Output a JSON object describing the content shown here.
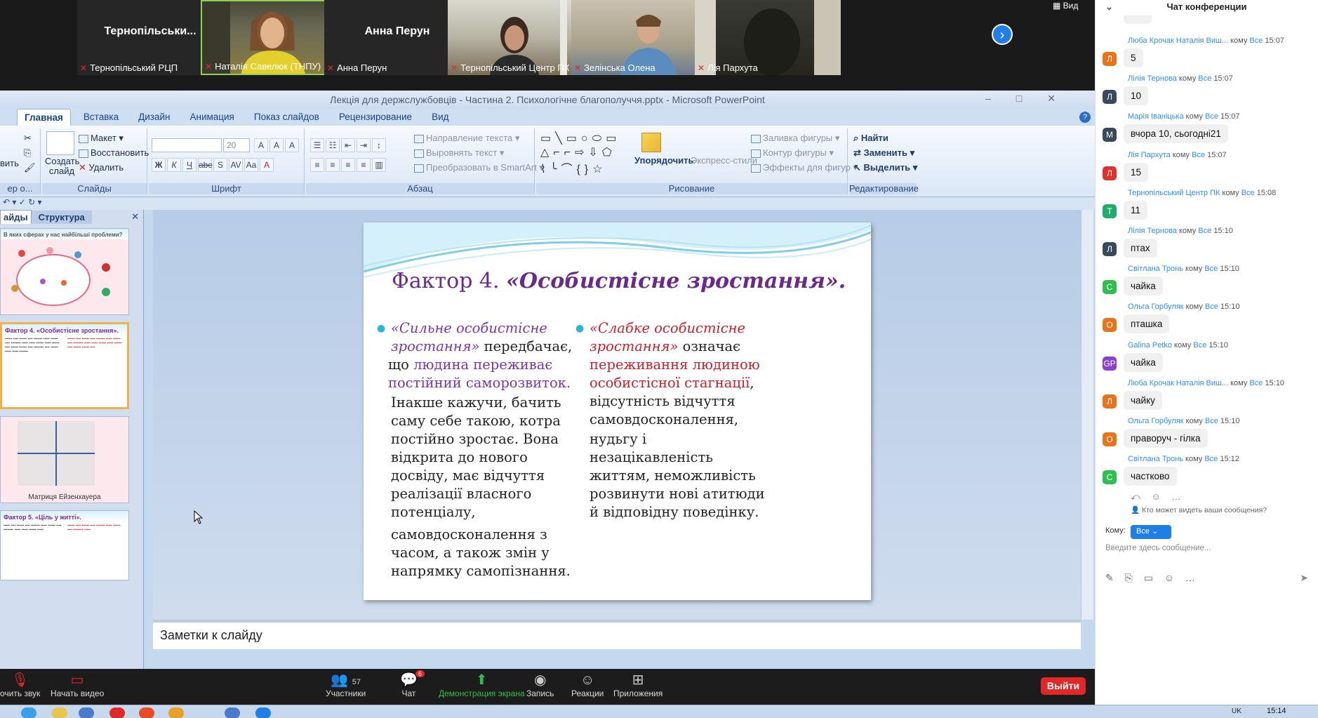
{
  "video": {
    "tiles": [
      {
        "name": "Тернопільськи...",
        "caption": "Тернопільський РЦП"
      },
      {
        "name": "",
        "caption": "Наталія Савелюк (ТНПУ)"
      },
      {
        "name": "Анна Перун",
        "caption": "Анна Перун"
      },
      {
        "name": "",
        "caption": "Тернопільський Центр ПК"
      },
      {
        "name": "",
        "caption": "Зелінська Олена"
      },
      {
        "name": "",
        "caption": "Лія Пархута"
      }
    ],
    "view_label": "Вид"
  },
  "ppt": {
    "title": "Лекція для держслужбовців - Частина 2. Психологічне благополуччя.pptx - Microsoft PowerPoint",
    "tabs": [
      "Главная",
      "Вставка",
      "Дизайн",
      "Анимация",
      "Показ слайдов",
      "Рецензирование",
      "Вид"
    ],
    "ribbon": {
      "insert_label": "вить",
      "create_slide_label": "Создать слайд",
      "layout": "Макет",
      "restore": "Восстановить",
      "delete": "Удалить",
      "slides_group": "Слайды",
      "font_size": "20",
      "font_group": "Шрифт",
      "text_direction": "Направление текста",
      "align_text": "Выровнять текст",
      "smartart": "Преобразовать в SmartArt",
      "paragraph_group": "Абзац",
      "arrange": "Упорядочить",
      "express_styles": "Экспресс-стили",
      "fill": "Заливка фигуры",
      "outline": "Контур фигуры",
      "effects": "Эффекты для фигур",
      "drawing_group": "Рисование",
      "find": "Найти",
      "replace": "Заменить",
      "select": "Выделить",
      "editing_group": "Редактирование"
    },
    "left_tabs": [
      "айды",
      "Структура"
    ],
    "thumbs": [
      {
        "title": "В яких сферах у нас найбільші проблеми?"
      },
      {
        "title": "Фактор 4. «Особистісне зростання»."
      },
      {
        "title": "Матриця Ейзенхауера"
      },
      {
        "title": "Фактор 5. «Ціль у житті»."
      }
    ],
    "slide": {
      "title_plain": "Фактор 4. ",
      "title_bold": "«Особистісне зростання».",
      "left": {
        "a_italic": "«Сильне особистісне зростання»",
        "a_tail": " передбачає,",
        "b_pre": "що ",
        "b_purple": "людина переживає постійний саморозвиток.",
        "c_text": "Інакше кажучи, бачить саму себе такою, котра постійно зростає. Вона відкрита до нового досвіду, має відчуття реалізації власного потенціалу,",
        "d_text": "самовдосконалення з часом, а також змін у напрямку самопізнання."
      },
      "right": {
        "a_italic": "«Слабке особистісне зростання»",
        "a_tail": " означає",
        "b_red": "переживання людиною особистісної стагнації",
        "b_tail": ", відсутність відчуття самовдосконалення,",
        "c_text": "нудьгу і незацікавленість життям, неможливість розвинути нові атитюди й відповідну поведінку."
      }
    },
    "notes": "Заметки к слайду"
  },
  "zoom_bar": {
    "mute": "очить звук",
    "video": "Начать видео",
    "participants": "Участники",
    "participants_count": "57",
    "chat": "Чат",
    "chat_badge": "6",
    "share": "Демонстрация экрана",
    "record": "Запись",
    "reactions": "Реакции",
    "apps": "Приложения",
    "leave": "Выйти"
  },
  "chat": {
    "title": "Чат конференции",
    "messages": [
      {
        "from": "Люба Крочак Наталія Виш...",
        "time": "15:07",
        "text": "5",
        "avatar": "Л",
        "color": "#e8731a"
      },
      {
        "from": "Лілія Тернова",
        "time": "15:07",
        "text": "10",
        "avatar": "Л",
        "color": "#39495c"
      },
      {
        "from": "Марія Іваніцька",
        "time": "15:07",
        "text": "вчора 10, сьогодні21",
        "avatar": "М",
        "color": "#39495c"
      },
      {
        "from": "Лія Пархута",
        "time": "15:07",
        "text": "15",
        "avatar": "Л",
        "color": "#e0322a"
      },
      {
        "from": "Тернопільський Центр ПК",
        "time": "15:08",
        "text": "11",
        "avatar": "Т",
        "color": "#1fae6a"
      },
      {
        "from": "Лілія Тернова",
        "time": "15:10",
        "text": "птах",
        "avatar": "Л",
        "color": "#39495c"
      },
      {
        "from": "Світлана Тронь",
        "time": "15:10",
        "text": "чайка",
        "avatar": "С",
        "color": "#2fbf4f"
      },
      {
        "from": "Ольга Горбуляк",
        "time": "15:10",
        "text": "пташка",
        "avatar": "О",
        "color": "#e8731a"
      },
      {
        "from": "Galina Petko",
        "time": "15:10",
        "text": "чайка",
        "avatar": "GP",
        "color": "#8a3fd0"
      },
      {
        "from": "Люба Крочак Наталія Виш...",
        "time": "15:10",
        "text": "чайку",
        "avatar": "Л",
        "color": "#e8731a"
      },
      {
        "from": "Ольга Горбуляк",
        "time": "15:10",
        "text": "праворуч - гілка",
        "avatar": "О",
        "color": "#e8731a"
      },
      {
        "from": "Світлана Тронь",
        "time": "15:12",
        "text": "частково",
        "avatar": "С",
        "color": "#2fbf4f"
      }
    ],
    "to_word": "кому",
    "all": "Все",
    "who_can_see": "Кто может видеть ваши сообщения?",
    "to_label": "Кому:",
    "to_value": "Все",
    "input_placeholder": "Введите здесь сообщение..."
  },
  "taskbar": {
    "clock": "15:14",
    "lang": "UK"
  }
}
